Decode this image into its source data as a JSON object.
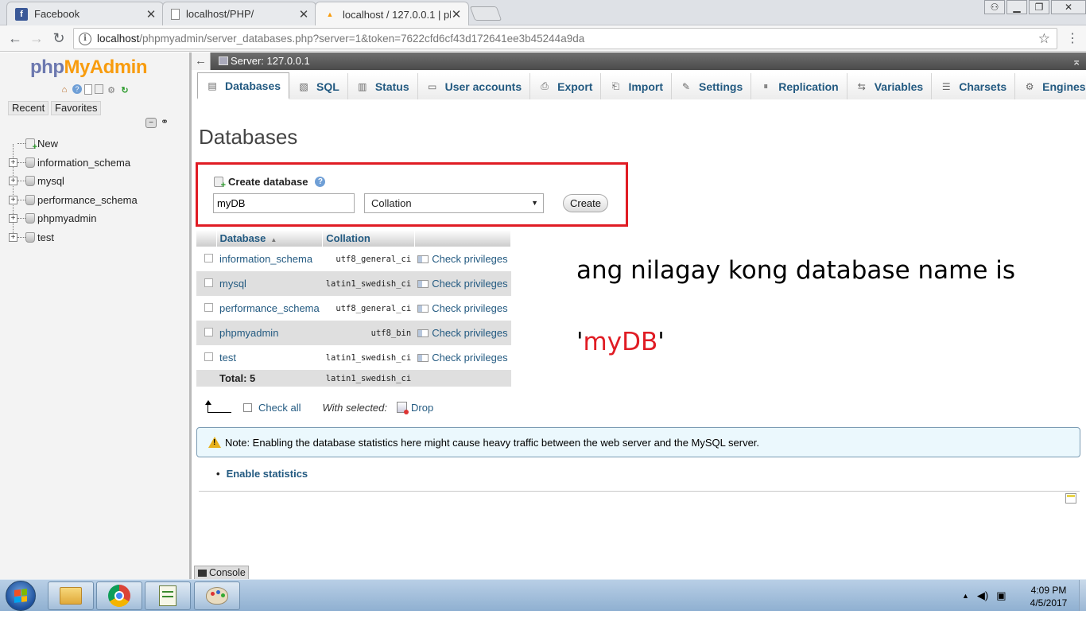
{
  "browser": {
    "tabs": [
      {
        "label": "Facebook",
        "icon": "facebook-icon"
      },
      {
        "label": "localhost/PHP/",
        "icon": "page-icon"
      },
      {
        "label": "localhost / 127.0.0.1 | php",
        "icon": "phpmyadmin-icon",
        "active": true
      }
    ],
    "close_glyph": "✕",
    "url_host": "localhost",
    "url_rest": "/phpmyadmin/server_databases.php?server=1&token=7622cfd6cf43d172641ee3b45244a9da"
  },
  "sidebar": {
    "logo_php": "php",
    "logo_myadmin": "MyAdmin",
    "recent_label": "Recent",
    "favorites_label": "Favorites",
    "new_label": "New",
    "databases": [
      "information_schema",
      "mysql",
      "performance_schema",
      "phpmyadmin",
      "test"
    ]
  },
  "serverbar": {
    "label": "Server: 127.0.0.1"
  },
  "menu": {
    "tabs": [
      {
        "label": "Databases",
        "icon": "databases-icon",
        "active": true
      },
      {
        "label": "SQL",
        "icon": "sql-icon"
      },
      {
        "label": "Status",
        "icon": "status-icon"
      },
      {
        "label": "User accounts",
        "icon": "user-accounts-icon"
      },
      {
        "label": "Export",
        "icon": "export-icon"
      },
      {
        "label": "Import",
        "icon": "import-icon"
      },
      {
        "label": "Settings",
        "icon": "settings-icon"
      },
      {
        "label": "Replication",
        "icon": "replication-icon"
      },
      {
        "label": "Variables",
        "icon": "variables-icon"
      },
      {
        "label": "Charsets",
        "icon": "charsets-icon"
      },
      {
        "label": "Engines",
        "icon": "engines-icon"
      }
    ]
  },
  "main": {
    "title": "Databases",
    "create": {
      "heading": "Create database",
      "db_name_value": "myDB",
      "collation_selected": "Collation",
      "create_button": "Create"
    },
    "table": {
      "headers": {
        "database": "Database",
        "collation": "Collation"
      },
      "rows": [
        {
          "name": "information_schema",
          "collation": "utf8_general_ci",
          "action": "Check privileges"
        },
        {
          "name": "mysql",
          "collation": "latin1_swedish_ci",
          "action": "Check privileges"
        },
        {
          "name": "performance_schema",
          "collation": "utf8_general_ci",
          "action": "Check privileges"
        },
        {
          "name": "phpmyadmin",
          "collation": "utf8_bin",
          "action": "Check privileges"
        },
        {
          "name": "test",
          "collation": "latin1_swedish_ci",
          "action": "Check privileges"
        }
      ],
      "total_label": "Total: 5",
      "total_collation": "latin1_swedish_ci"
    },
    "actions": {
      "check_all": "Check all",
      "with_selected": "With selected:",
      "drop": "Drop"
    },
    "notice": "Note: Enabling the database statistics here might cause heavy traffic between the web server and the MySQL server.",
    "enable_statistics": "Enable statistics",
    "console": "Console"
  },
  "annotation": {
    "line1": "ang nilagay kong database name is",
    "line2_open": "'",
    "line2_value": "myDB",
    "line2_close": "'"
  },
  "taskbar": {
    "time": "4:09 PM",
    "date": "4/5/2017"
  },
  "colors": {
    "link_blue": "#235a81",
    "highlight_red": "#e01c24",
    "logo_php": "#6c78af",
    "logo_myadmin": "#f89c0e"
  }
}
